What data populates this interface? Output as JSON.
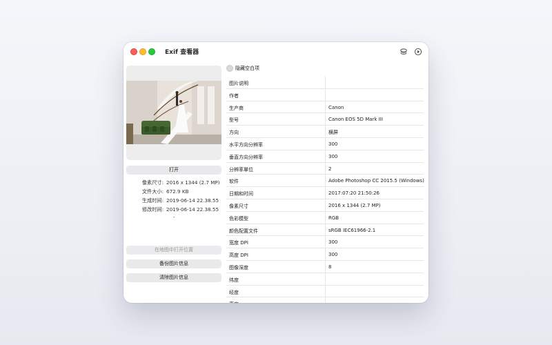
{
  "window": {
    "title": "Exif 查看器"
  },
  "left": {
    "open_button": "打开",
    "info": [
      {
        "label": "像素尺寸:",
        "value": "2016 x 1344 (2.7 MP)"
      },
      {
        "label": "文件大小:",
        "value": "672.9 KB"
      },
      {
        "label": "生成时间:",
        "value": "2019-06-14 22.38.55"
      },
      {
        "label": "修改时间:",
        "value": "2019-06-14 22.38.55"
      }
    ],
    "dash": "-",
    "map_button": "在地图中打开位置",
    "backup_button": "备份图片信息",
    "clear_button": "清除图片信息"
  },
  "right": {
    "hide_empty_label": "隐藏空白项",
    "rows": [
      {
        "key": "图片说明",
        "value": ""
      },
      {
        "key": "作者",
        "value": ""
      },
      {
        "key": "生产商",
        "value": "Canon"
      },
      {
        "key": "型号",
        "value": "Canon EOS 5D Mark III"
      },
      {
        "key": "方向",
        "value": "横屏"
      },
      {
        "key": "水平方向分辨率",
        "value": "300"
      },
      {
        "key": "垂直方向分辨率",
        "value": "300"
      },
      {
        "key": "分辨率單位",
        "value": "2"
      },
      {
        "key": "软件",
        "value": "Adobe Photoshop CC 2015.5 (Windows)"
      },
      {
        "key": "日期和时间",
        "value": "2017:07:20 21:50:26"
      },
      {
        "key": "像素尺寸",
        "value": "2016 x 1344 (2.7 MP)"
      },
      {
        "key": "色彩模型",
        "value": "RGB"
      },
      {
        "key": "颜色配置文件",
        "value": "sRGB IEC61966-2.1"
      },
      {
        "key": "宽度 DPI",
        "value": "300"
      },
      {
        "key": "高度 DPI",
        "value": "300"
      },
      {
        "key": "图像深度",
        "value": "8"
      },
      {
        "key": "纬度",
        "value": ""
      },
      {
        "key": "经度",
        "value": ""
      },
      {
        "key": "高度",
        "value": ""
      }
    ]
  },
  "icons": {
    "toolbar_left": "stack-layers-icon",
    "toolbar_right": "play-circle-icon"
  }
}
